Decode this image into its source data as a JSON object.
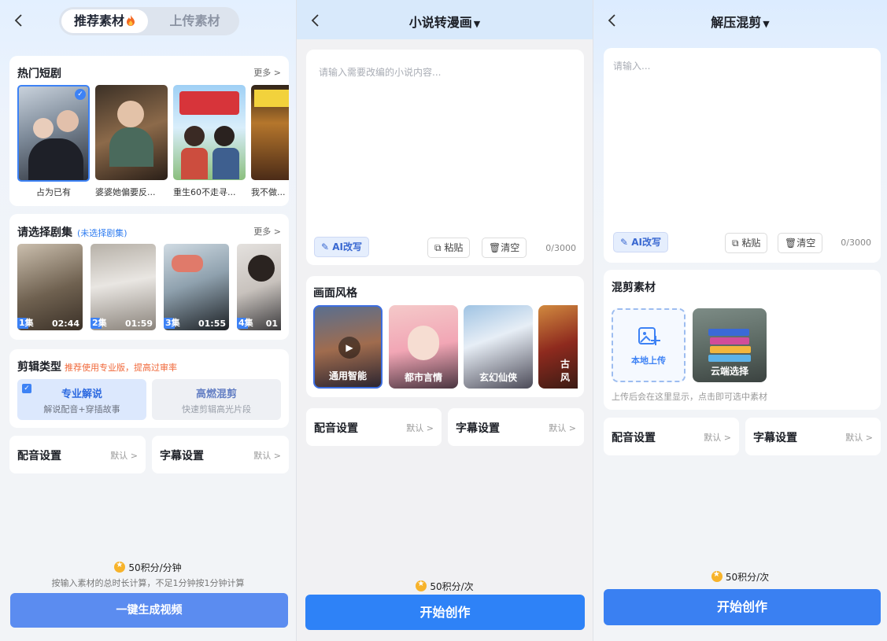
{
  "screen1": {
    "tabs": [
      "推荐素材",
      "上传素材"
    ],
    "hot": {
      "title": "热门短剧",
      "more": "更多 >",
      "items": [
        "占为已有",
        "婆婆她偏要反...",
        "重生60不走寻...",
        "我不做..."
      ]
    },
    "episodes": {
      "title": "请选择剧集",
      "hint": "(未选择剧集)",
      "more": "更多 >",
      "items": [
        {
          "ep": "1集",
          "time": "02:44"
        },
        {
          "ep": "2集",
          "time": "01:59"
        },
        {
          "ep": "3集",
          "time": "01:55"
        },
        {
          "ep": "4集",
          "time": "01"
        }
      ]
    },
    "edit_type": {
      "title": "剪辑类型",
      "hint": "推荐使用专业版，提高过审率",
      "options": [
        {
          "title": "专业解说",
          "sub": "解说配音+穿插故事"
        },
        {
          "title": "高燃混剪",
          "sub": "快速剪辑高光片段"
        }
      ]
    },
    "rows": [
      {
        "label": "配音设置",
        "value": "默认 >"
      },
      {
        "label": "字幕设置",
        "value": "默认 >"
      }
    ],
    "cost": "50积分/分钟",
    "cost_note": "按输入素材的总时长计算，不足1分钟按1分钟计算",
    "button": "一键生成视频"
  },
  "screen2": {
    "title": "小说转漫画",
    "placeholder": "请输入需要改编的小说内容...",
    "ai_button": "AI改写",
    "paste": "粘贴",
    "clear": "清空",
    "count": "0/3000",
    "style_title": "画面风格",
    "styles": [
      "通用智能",
      "都市言情",
      "玄幻仙侠",
      "古风"
    ],
    "rows": [
      {
        "label": "配音设置",
        "value": "默认 >"
      },
      {
        "label": "字幕设置",
        "value": "默认 >"
      }
    ],
    "cost": "50积分/次",
    "button": "开始创作"
  },
  "screen3": {
    "title": "解压混剪",
    "placeholder": "请输入...",
    "ai_button": "AI改写",
    "paste": "粘贴",
    "clear": "清空",
    "count": "0/3000",
    "material_title": "混剪素材",
    "upload_label": "本地上传",
    "cloud_label": "云端选择",
    "material_note": "上传后会在这里显示，点击即可选中素材",
    "rows": [
      {
        "label": "配音设置",
        "value": "默认 >"
      },
      {
        "label": "字幕设置",
        "value": "默认 >"
      }
    ],
    "cost": "50积分/次",
    "button": "开始创作"
  },
  "colors": {
    "accent": "#3d82f5",
    "button_soft": "#5b8cf0",
    "button_primary": "#2e82f7",
    "orange_hint": "#f0683a",
    "coin": "#f7b32b"
  }
}
